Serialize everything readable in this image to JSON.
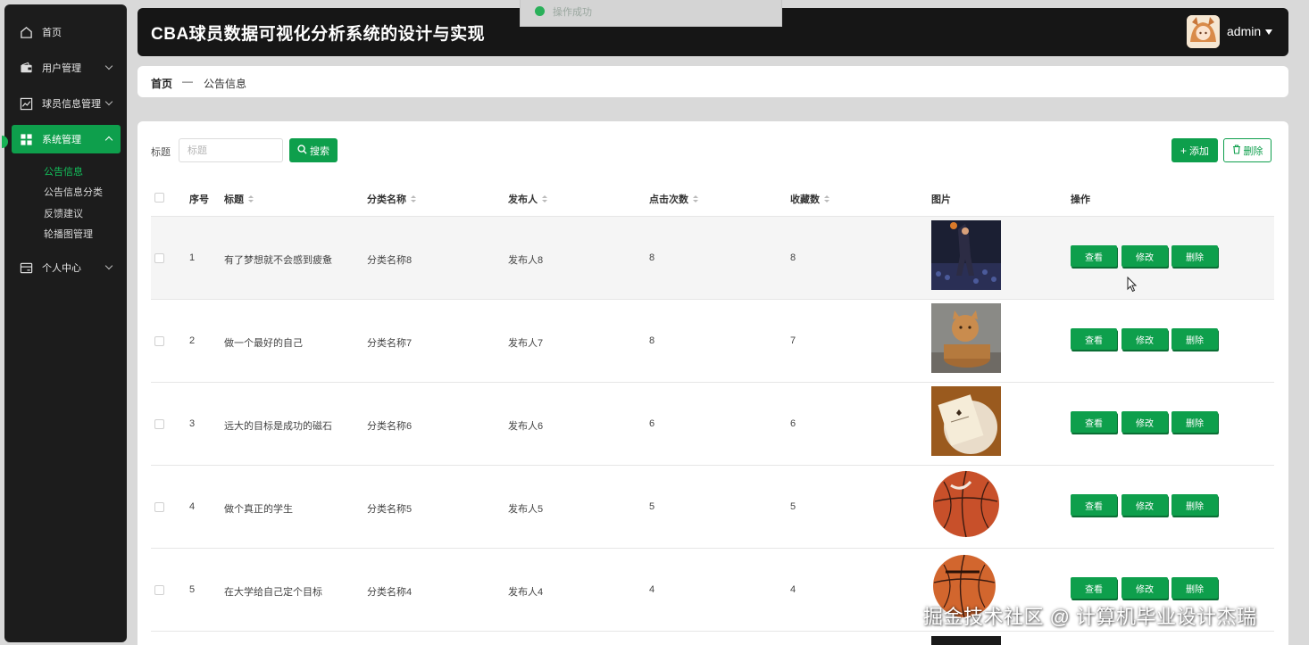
{
  "app": {
    "title": "CBA球员数据可视化分析系统的设计与实现",
    "user": "admin"
  },
  "toast": {
    "message": "操作成功"
  },
  "sidebar": {
    "items": [
      {
        "label": "首页",
        "icon": "home-icon"
      },
      {
        "label": "用户管理",
        "icon": "wallet-icon"
      },
      {
        "label": "球员信息管理",
        "icon": "chart-icon"
      },
      {
        "label": "系统管理",
        "icon": "grid-icon"
      },
      {
        "label": "个人中心",
        "icon": "card-icon"
      }
    ],
    "subitems": [
      "公告信息",
      "公告信息分类",
      "反馈建议",
      "轮播图管理"
    ]
  },
  "breadcrumb": {
    "home": "首页",
    "separator": "—",
    "current": "公告信息"
  },
  "search": {
    "label": "标题",
    "placeholder": "标题",
    "button": "搜索"
  },
  "toolbar": {
    "add": "添加",
    "delete": "删除"
  },
  "table": {
    "headers": {
      "index": "序号",
      "title": "标题",
      "category": "分类名称",
      "publisher": "发布人",
      "clicks": "点击次数",
      "favorites": "收藏数",
      "image": "图片",
      "actions": "操作"
    },
    "rows": [
      {
        "index": "1",
        "title": "有了梦想就不会感到疲惫",
        "category": "分类名称8",
        "publisher": "发布人8",
        "clicks": "8",
        "favorites": "8",
        "image": "basketball-player-photo"
      },
      {
        "index": "2",
        "title": "做一个最好的自己",
        "category": "分类名称7",
        "publisher": "发布人7",
        "clicks": "8",
        "favorites": "7",
        "image": "cat-figurine-photo"
      },
      {
        "index": "3",
        "title": "远大的目标是成功的磁石",
        "category": "分类名称6",
        "publisher": "发布人6",
        "clicks": "6",
        "favorites": "6",
        "image": "greeting-card-photo"
      },
      {
        "index": "4",
        "title": "做个真正的学生",
        "category": "分类名称5",
        "publisher": "发布人5",
        "clicks": "5",
        "favorites": "5",
        "image": "lining-basketball-photo"
      },
      {
        "index": "5",
        "title": "在大学给自己定个目标",
        "category": "分类名称4",
        "publisher": "发布人4",
        "clicks": "4",
        "favorites": "4",
        "image": "lenwave-basketball-photo"
      }
    ],
    "row_actions": {
      "view": "查看",
      "edit": "修改",
      "delete": "删除"
    }
  },
  "watermark": "掘金技术社区 @ 计算机毕业设计杰瑞",
  "colors": {
    "accent": "#0e9f4c",
    "sidebar_bg": "#1c1c1c",
    "header_bg": "#161616"
  }
}
